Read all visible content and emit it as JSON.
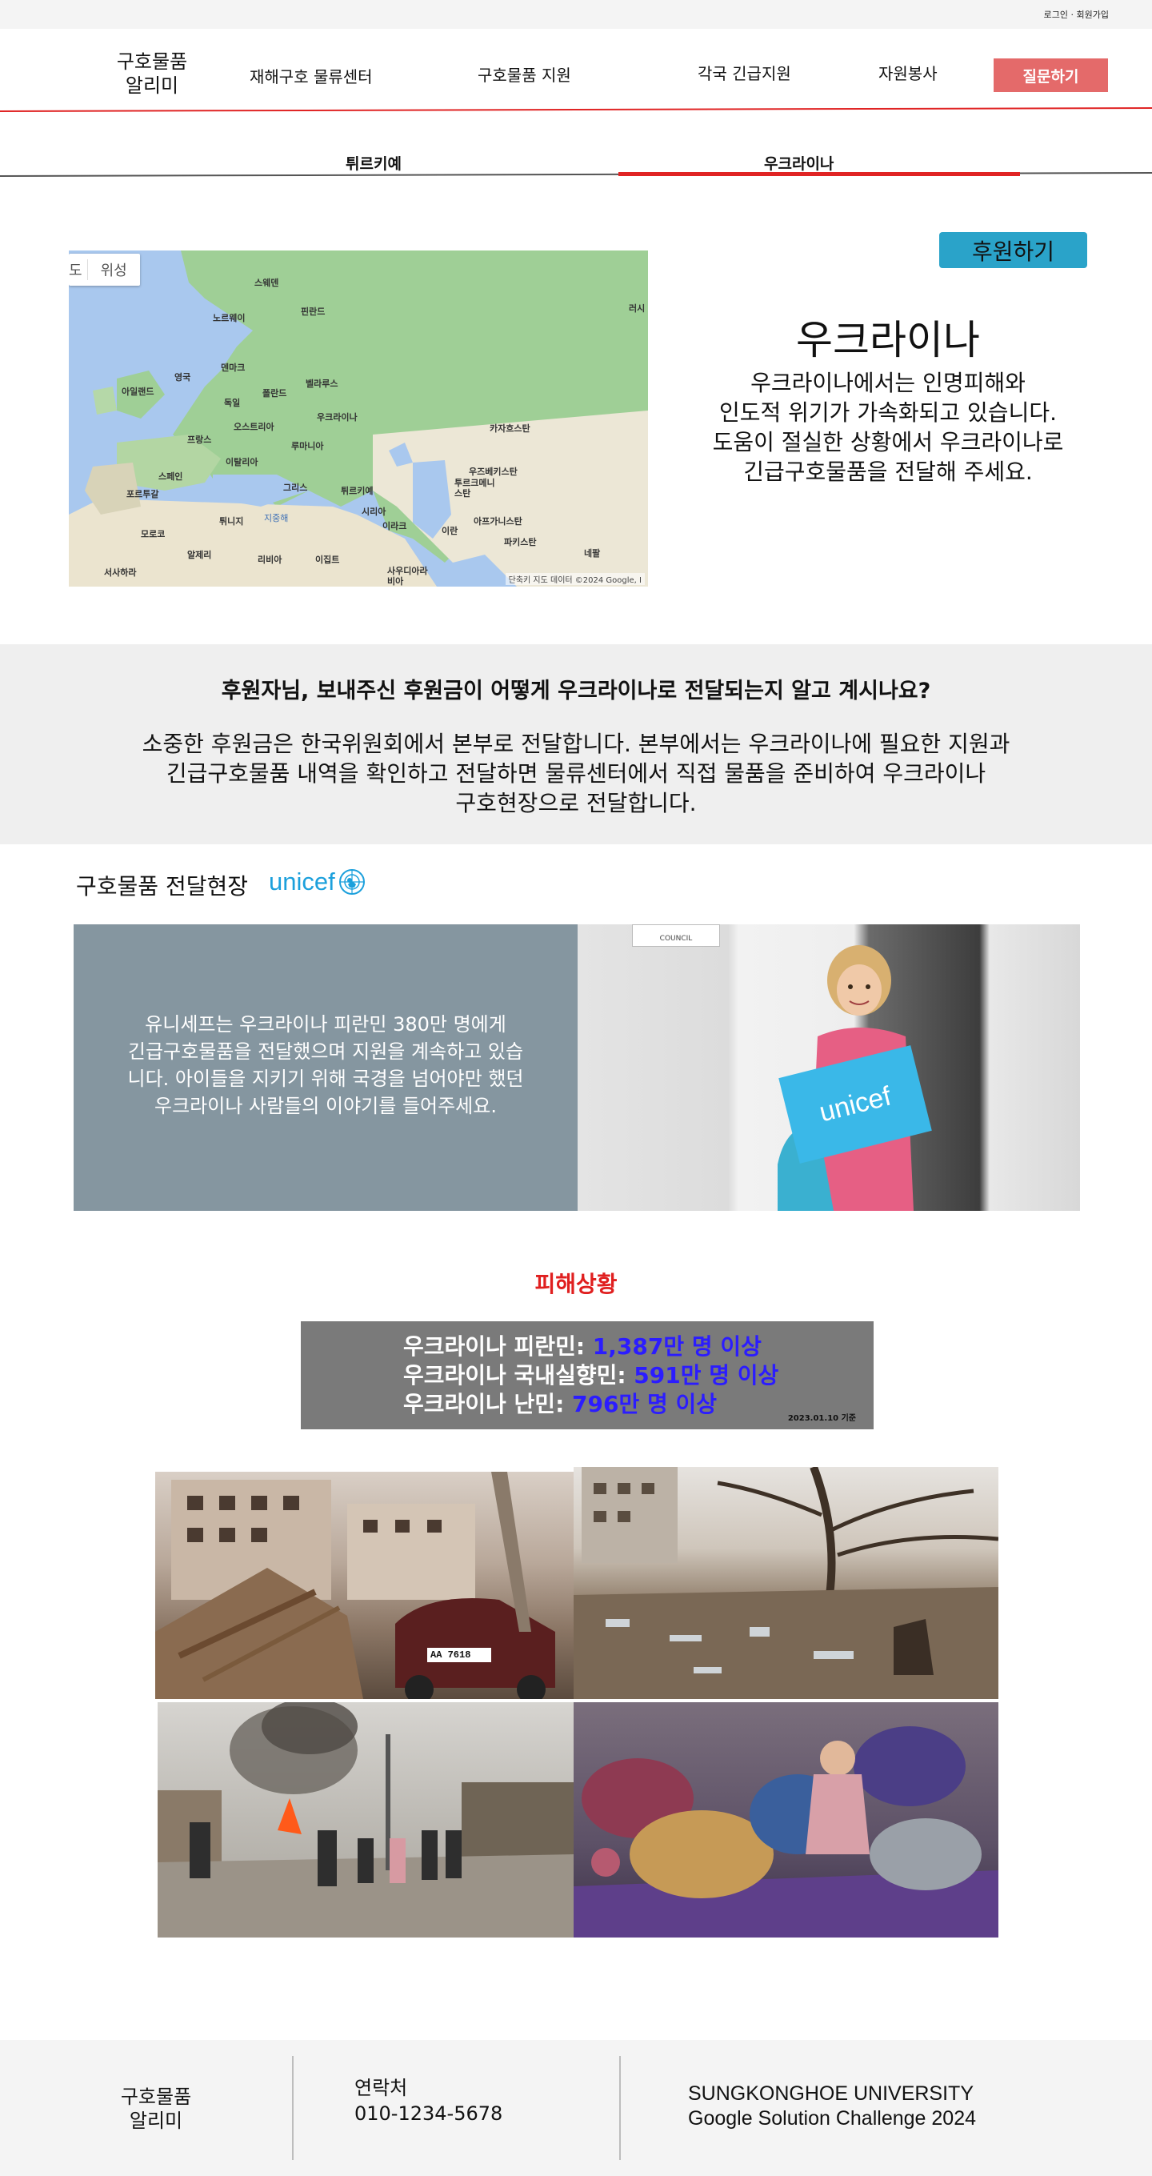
{
  "topbar": {
    "auth_links": "로그인 · 회원가입"
  },
  "header": {
    "logo_line1": "구호물품",
    "logo_line2": "알리미",
    "nav": [
      {
        "label": "재해구호 물류센터"
      },
      {
        "label": "구호물품 지원"
      },
      {
        "label": "각국 긴급지원"
      },
      {
        "label": "자원봉사"
      }
    ],
    "ask_button": "질문하기",
    "accent_color": "#e02424"
  },
  "country_tabs": {
    "items": [
      {
        "label": "튀르키예"
      },
      {
        "label": "우크라이나"
      }
    ],
    "active": "우크라이나"
  },
  "map": {
    "toggle_partial": "도",
    "toggle_label": "위성",
    "attribution": "단축키   지도 데이터 ©2024 Google, I",
    "places": [
      "스웨덴",
      "노르웨이",
      "핀란드",
      "러시",
      "덴마크",
      "영국",
      "아일랜드",
      "독일",
      "폴란드",
      "벨라루스",
      "프랑스",
      "오스트리아",
      "우크라이나",
      "루마니아",
      "카자흐스탄",
      "이탈리아",
      "스페인",
      "그리스",
      "튀르키예",
      "우즈베키스탄",
      "투르크메니스탄",
      "포르투갈",
      "튀니지",
      "시리아",
      "이라크",
      "이란",
      "아프가니스탄",
      "모로코",
      "알제리",
      "리비아",
      "이집트",
      "사우디아라비아",
      "파키스탄",
      "네팔",
      "서사하라",
      "지중해"
    ]
  },
  "country": {
    "donate_button": "후원하기",
    "title": "우크라이나",
    "desc_lines": [
      "우크라이나에서는  인명피해와",
      "인도적 위기가 가속화되고 있습니다.",
      "도움이 절실한 상황에서 우크라이나로",
      "긴급구호물품을 전달해 주세요."
    ]
  },
  "explain": {
    "title": "후원자님, 보내주신 후원금이 어떻게 우크라이나로 전달되는지 알고 계시나요?",
    "body_lines": [
      "소중한 후원금은 한국위원회에서 본부로 전달합니다. 본부에서는 우크라이나에 필요한 지원과",
      "긴급구호물품 내역을 확인하고 전달하면 물류센터에서 직접 물품을 준비하여 우크라이나",
      "구호현장으로 전달합니다."
    ]
  },
  "delivery": {
    "title": "구호물품 전달현장",
    "logo_text": "unicef",
    "panel_lines": [
      "유니세프는 우크라이나 피란민 380만 명에게",
      "긴급구호물품을 전달했으며 지원을 계속하고 있습",
      "니다. 아이들을 지키기 위해 국경을 넘어야만 했던",
      "우크라이나 사람들의 이야기를 들어주세요."
    ],
    "photo_sign": "COUNCIL",
    "photo_card_text": "unicef"
  },
  "damage": {
    "title": "피해상황",
    "stats": [
      {
        "label": "우크라이나 피란민: ",
        "value": "1,387만 명 이상"
      },
      {
        "label": "우크라이나 국내실향민:  ",
        "value": "591만 명 이상"
      },
      {
        "label": "우크라이나 난민: ",
        "value": "796만 명 이상"
      }
    ],
    "date": "2023.01.10 기준",
    "photo_plate": "AA 7618",
    "value_color": "#2b1cff"
  },
  "footer": {
    "logo_line1": "구호물품",
    "logo_line2": "알리미",
    "contact_label": "연락처",
    "contact_phone": "010-1234-5678",
    "org_line1": "SUNGKONGHOE UNIVERSITY",
    "org_line2": "Google Solution Challenge 2024"
  }
}
